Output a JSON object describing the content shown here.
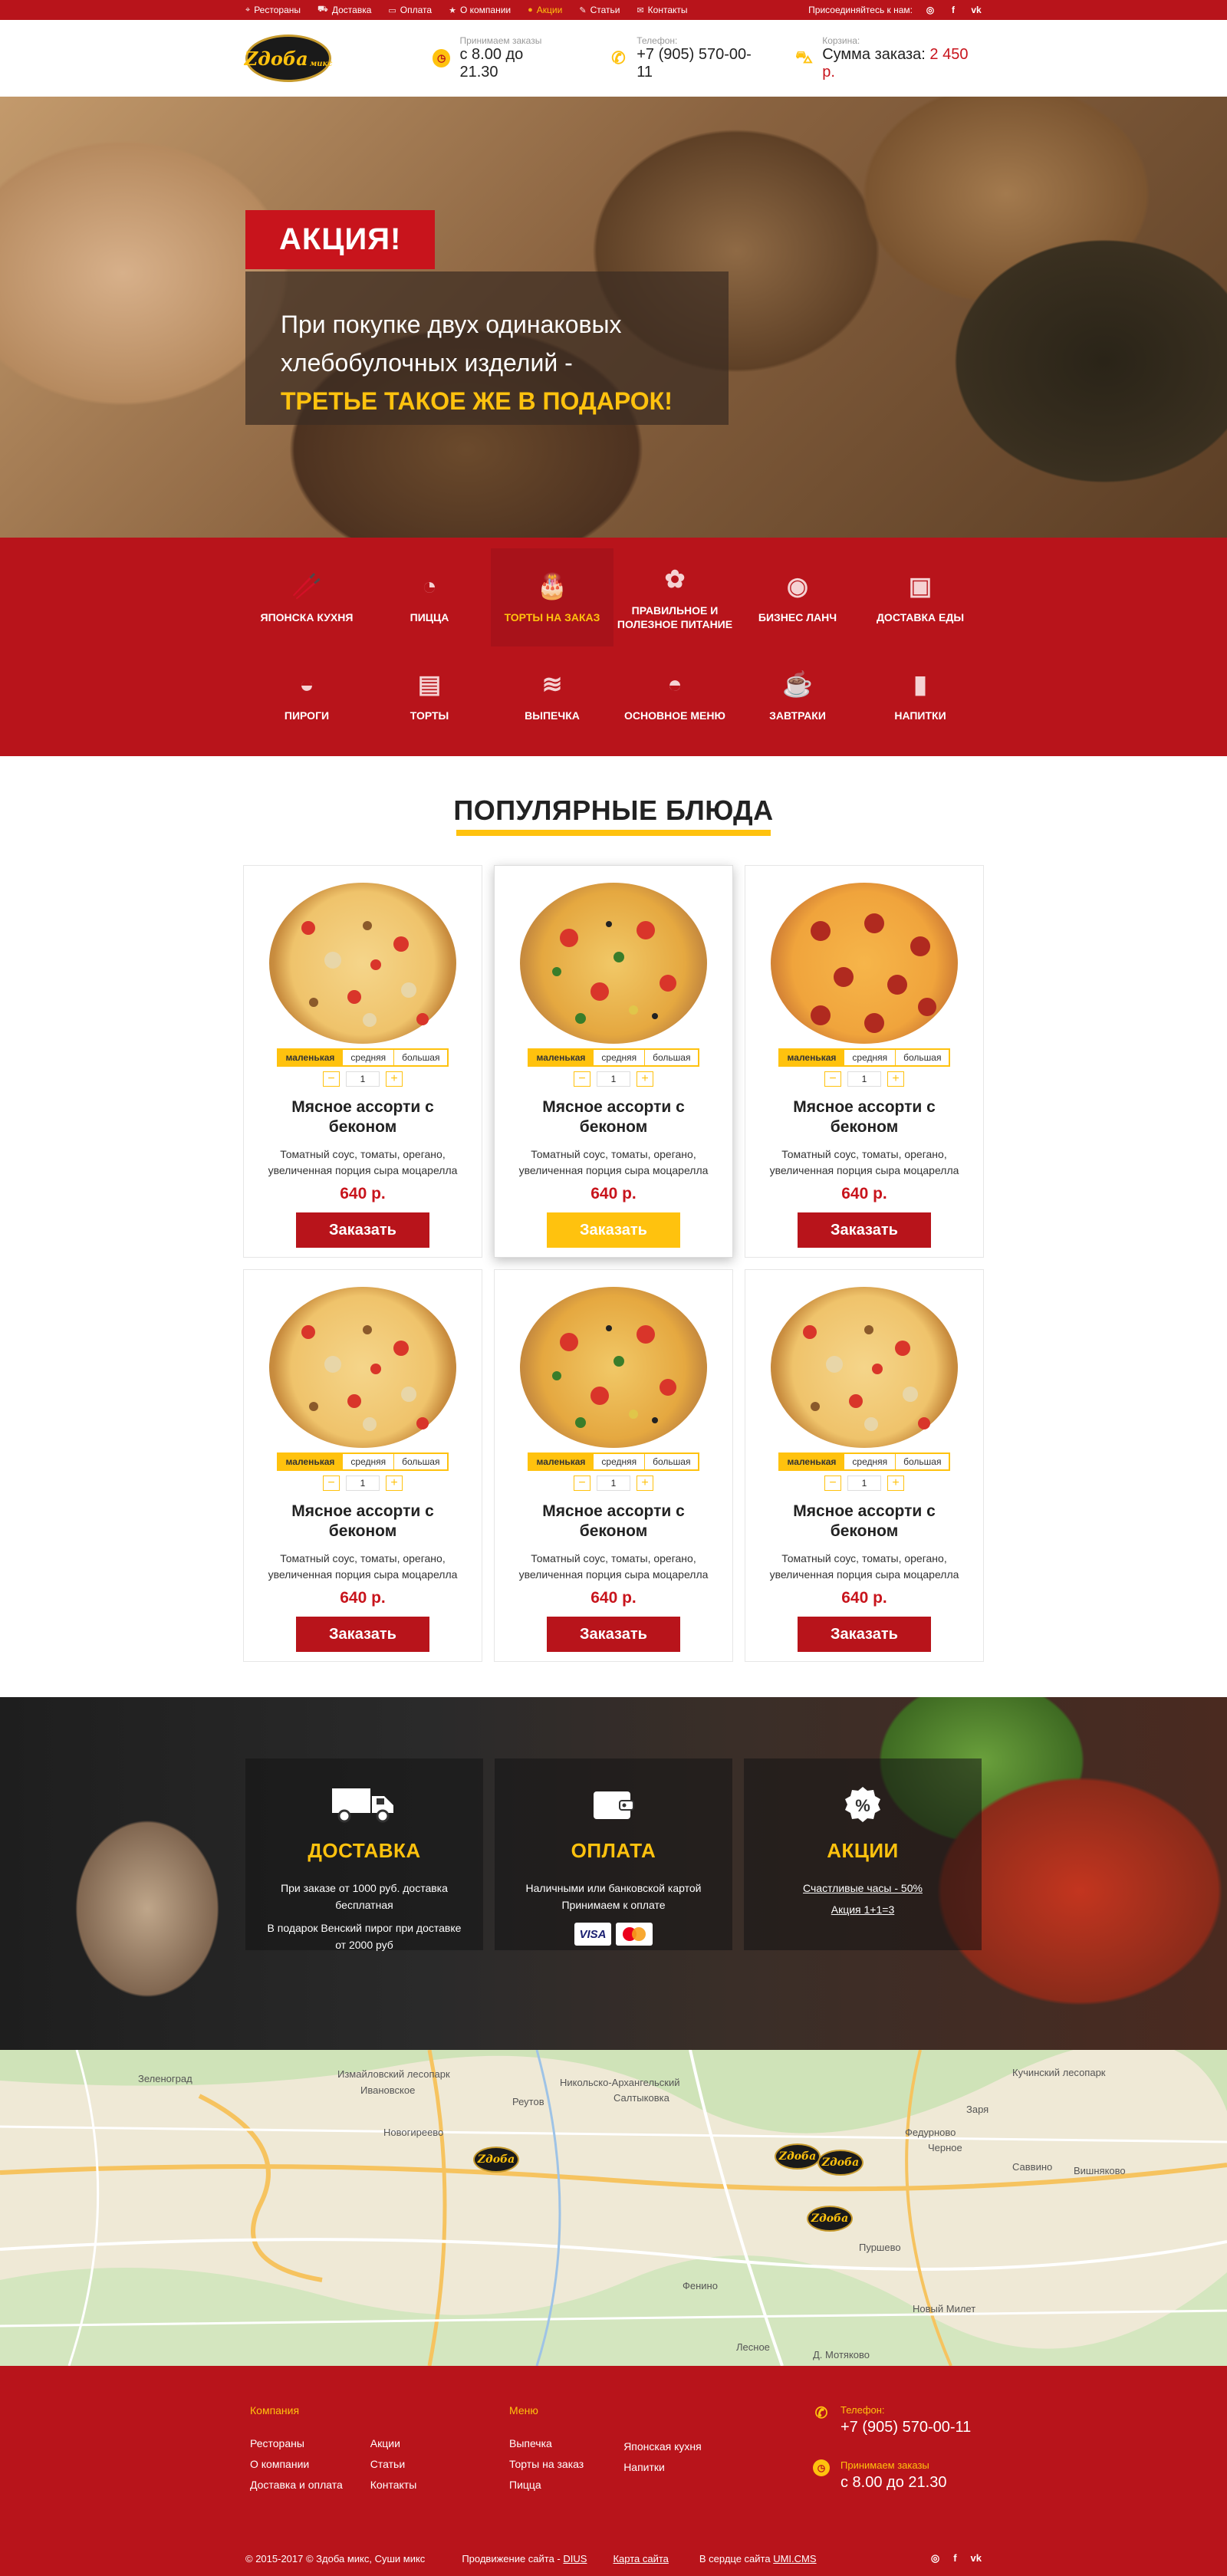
{
  "topbar": {
    "items": [
      {
        "icon": "pin-icon",
        "label": "Рестораны"
      },
      {
        "icon": "car-icon",
        "label": "Доставка"
      },
      {
        "icon": "wallet-icon",
        "label": "Оплата"
      },
      {
        "icon": "star-icon",
        "label": "О компании"
      },
      {
        "icon": "sale-icon",
        "label": "Акции"
      },
      {
        "icon": "edit-icon",
        "label": "Статьи"
      },
      {
        "icon": "mail-icon",
        "label": "Контакты"
      }
    ],
    "join_label": "Присоединяйтесь к нам:",
    "social": [
      "instagram-icon",
      "facebook-icon",
      "vk-icon"
    ]
  },
  "header": {
    "logo_text": "Zдоба",
    "logo_sub": "микс",
    "hours_label": "Принимаем заказы",
    "hours_value": "с 8.00  до 21.30",
    "phone_label": "Телефон:",
    "phone_value": "+7 (905) 570-00-11",
    "cart_label": "Корзина:",
    "cart_text": "Сумма заказа:",
    "cart_sum": "2 450 р."
  },
  "hero": {
    "tag": "АКЦИЯ!",
    "line1": "При покупке двух одинаковых",
    "line2": "хлебобулочных изделий -",
    "line3": "ТРЕТЬЕ ТАКОЕ ЖЕ В ПОДАРОК!",
    "slides": 4
  },
  "categories": [
    {
      "icon": "sushi-icon",
      "label": "ЯПОНСКА КУХНЯ"
    },
    {
      "icon": "pizza-icon",
      "label": "ПИЦЦА"
    },
    {
      "icon": "cake-icon",
      "label": "ТОРТЫ НА ЗАКАЗ",
      "active": true
    },
    {
      "icon": "carrot-icon",
      "label": "ПРАВИЛЬНОЕ И ПОЛЕЗНОЕ ПИТАНИЕ"
    },
    {
      "icon": "plate-icon",
      "label": "БИЗНЕС ЛАНЧ"
    },
    {
      "icon": "bag-icon",
      "label": "ДОСТАВКА ЕДЫ"
    },
    {
      "icon": "pie-icon",
      "label": "ПИРОГИ"
    },
    {
      "icon": "layer-cake-icon",
      "label": "ТОРТЫ"
    },
    {
      "icon": "pastry-icon",
      "label": "ВЫПЕЧКА"
    },
    {
      "icon": "cloche-icon",
      "label": "ОСНОВНОЕ МЕНЮ"
    },
    {
      "icon": "coffee-icon",
      "label": "ЗАВТРАКИ"
    },
    {
      "icon": "cup-icon",
      "label": "НАПИТКИ"
    }
  ],
  "popular": {
    "title": "ПОПУЛЯРНЫЕ БЛЮДА",
    "sizes": [
      "маленькая",
      "средняя",
      "большая"
    ],
    "items": [
      {
        "kind": "meat",
        "qty": "1",
        "name": "Мясное ассорти с беконом",
        "desc": "Томатный соус, томаты, орегано, увеличенная порция сыра моцарелла",
        "price": "640 р.",
        "button": "Заказать"
      },
      {
        "kind": "veg",
        "qty": "1",
        "name": "Мясное ассорти с беконом",
        "desc": "Томатный соус, томаты, орегано, увеличенная порция сыра моцарелла",
        "price": "640 р.",
        "button": "Заказать",
        "highlight": true
      },
      {
        "kind": "pep",
        "qty": "1",
        "name": "Мясное ассорти с беконом",
        "desc": "Томатный соус, томаты, орегано, увеличенная порция сыра моцарелла",
        "price": "640 р.",
        "button": "Заказать"
      },
      {
        "kind": "meat",
        "qty": "1",
        "name": "Мясное ассорти с беконом",
        "desc": "Томатный соус, томаты, орегано, увеличенная порция сыра моцарелла",
        "price": "640 р.",
        "button": "Заказать"
      },
      {
        "kind": "veg",
        "qty": "1",
        "name": "Мясное ассорти с беконом",
        "desc": "Томатный соус, томаты, орегано, увеличенная порция сыра моцарелла",
        "price": "640 р.",
        "button": "Заказать"
      },
      {
        "kind": "meat",
        "qty": "1",
        "name": "Мясное ассорти с беконом",
        "desc": "Томатный соус, томаты, орегано, увеличенная порция сыра моцарелла",
        "price": "640 р.",
        "button": "Заказать"
      }
    ]
  },
  "features": {
    "delivery": {
      "title": "ДОСТАВКА",
      "text1": "При заказе от 1000 руб. доставка бесплатная",
      "text2": "В подарок Венский пирог при доставке от 2000 руб"
    },
    "payment": {
      "title": "ОПЛАТА",
      "text1": "Наличными или банковской картой",
      "text2": "Принимаем к оплате",
      "visa": "VISA"
    },
    "sales": {
      "title": "АКЦИИ",
      "link1": "Счастливые часы - 50%",
      "link2": "Акция 1+1=3"
    }
  },
  "map": {
    "labels": [
      "Реутов",
      "Никольско-Архангельский",
      "Салтыковка",
      "Новогиреево",
      "Ивановское",
      "Зеленоград",
      "Фенино",
      "Пуршево",
      "Федурново",
      "Черное",
      "Саввино",
      "Заря",
      "Вишняково",
      "Новый Милет",
      "Лесное",
      "Д. Мотяково",
      "Измайловский лесопарк",
      "Кучинский лесопарк"
    ],
    "pin_text": "Zдоба"
  },
  "footer": {
    "company_head": "Компания",
    "company_col1": [
      "Рестораны",
      "О компании",
      "Доставка и оплата"
    ],
    "company_col2": [
      "Акции",
      "Статьи",
      "Контакты"
    ],
    "menu_head": "Меню",
    "menu_col1": [
      "Выпечка",
      "Торты на заказ",
      "Пицца"
    ],
    "menu_col2": [
      "Японская кухня",
      "Напитки"
    ],
    "phone_label": "Телефон:",
    "phone_value": "+7 (905) 570-00-11",
    "hours_label": "Принимаем заказы",
    "hours_value": "с 8.00  до 21.30",
    "copyright": "© 2015-2017 © Здоба микс, Суши микс",
    "promo_text": "Продвижение сайта - ",
    "promo_link": "DIUS",
    "sitemap": "Карта сайта",
    "cms_text": "В сердце сайта ",
    "cms_link": "UMI.CMS"
  },
  "colors": {
    "brand_red": "#b8141b",
    "accent_yellow": "#ffc20e",
    "price_red": "#c8141c"
  }
}
